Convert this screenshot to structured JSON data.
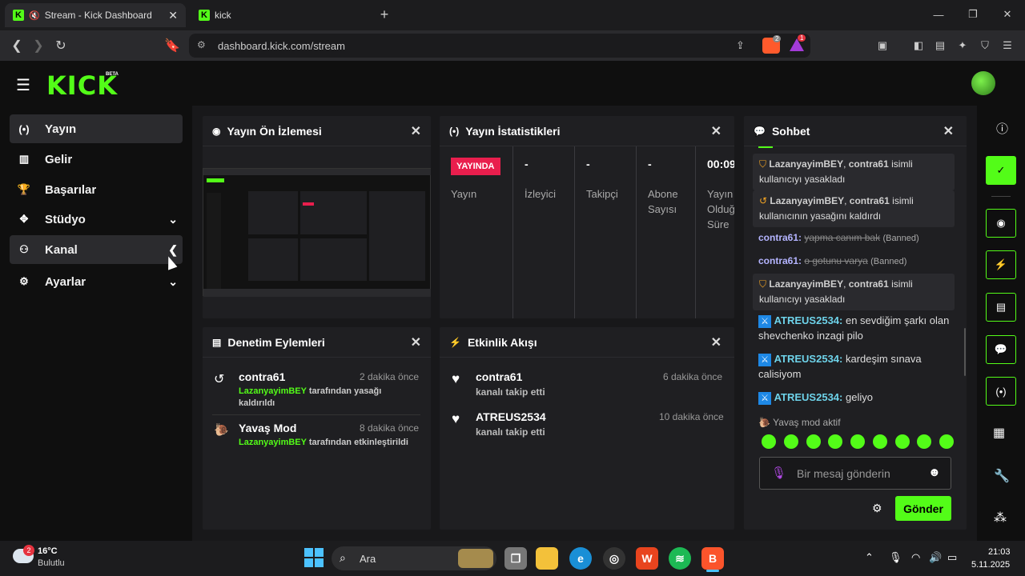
{
  "browser": {
    "tabs": [
      {
        "title": "Stream - Kick Dashboard"
      },
      {
        "title": "kick"
      }
    ],
    "url": "dashboard.kick.com/stream",
    "shield_badge": "2",
    "alert_badge": "1"
  },
  "header": {
    "logo": "KICK",
    "beta": "BETA"
  },
  "sidebar": {
    "items": [
      {
        "label": "Yayın"
      },
      {
        "label": "Gelir"
      },
      {
        "label": "Başarılar"
      },
      {
        "label": "Stüdyo"
      },
      {
        "label": "Kanal"
      },
      {
        "label": "Ayarlar"
      }
    ]
  },
  "panels": {
    "preview": {
      "title": "Yayın Ön İzlemesi"
    },
    "stats": {
      "title": "Yayın İstatistikleri",
      "live_badge": "YAYINDA",
      "items": [
        {
          "value": "",
          "label": "Yayın"
        },
        {
          "value": "-",
          "label": "İzleyici"
        },
        {
          "value": "-",
          "label": "Takipçi"
        },
        {
          "value": "-",
          "label": "Abone Sayısı"
        },
        {
          "value": "00:09",
          "label": "Yayın Olduğ Süre"
        }
      ]
    },
    "moderation": {
      "title": "Denetim Eylemleri",
      "entries": [
        {
          "name": "contra61",
          "time": "2 dakika önce",
          "actor": "LazanyayimBEY",
          "action": " tarafından yasağı kaldırıldı"
        },
        {
          "name": "Yavaş Mod",
          "time": "8 dakika önce",
          "actor": "LazanyayimBEY",
          "action": " tarafından etkinleştirildi"
        }
      ]
    },
    "activity": {
      "title": "Etkinlik Akışı",
      "entries": [
        {
          "name": "contra61",
          "time": "6 dakika önce",
          "desc": "kanalı takip etti"
        },
        {
          "name": "ATREUS2534",
          "time": "10 dakika önce",
          "desc": "kanalı takip etti"
        }
      ]
    },
    "chat": {
      "title": "Sohbet",
      "messages": [
        {
          "user": "LazanyayimBEY",
          "sep": ", ",
          "target": "contra61",
          "text": " isimli kullanıcıyı yasakladı"
        },
        {
          "user": "LazanyayimBEY",
          "sep": ", ",
          "target": "contra61",
          "text": " isimli kullanıcının yasağını kaldırdı"
        },
        {
          "user": "contra61",
          "text": "yapma canım bak",
          "tag": "(Banned)"
        },
        {
          "user": "contra61",
          "text": "o gotunu varya",
          "tag": "(Banned)"
        },
        {
          "user": "LazanyayimBEY",
          "sep": ", ",
          "target": "contra61",
          "text": " isimli kullanıcıyı yasakladı"
        },
        {
          "user": "ATREUS2534",
          "text": " en sevdiğim şarkı olan shevchenko inzagi pilo"
        },
        {
          "user": "ATREUS2534",
          "text": " kardeşim sınava calisiyom"
        },
        {
          "user": "ATREUS2534",
          "text": " geliyo"
        }
      ],
      "slow_mode": "Yavaş mod aktif",
      "input_placeholder": "Bir mesaj gönderin",
      "send_label": "Gönder"
    }
  },
  "taskbar": {
    "weather_temp": "16°C",
    "weather_desc": "Bulutlu",
    "weather_badge": "2",
    "search_label": "Ara",
    "time": "21:03",
    "date": "5.11.2025"
  },
  "colors": {
    "accent": "#53fc18",
    "live": "#e91e4d",
    "background": "#0f0f0f",
    "panel": "#1f1f22"
  }
}
